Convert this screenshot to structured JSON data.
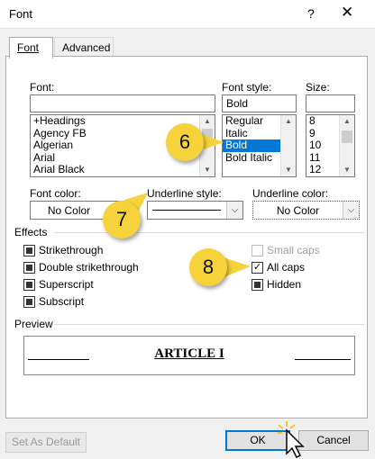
{
  "window": {
    "title": "Font",
    "help": "?",
    "close": "✕"
  },
  "tabs": [
    {
      "label": "Font"
    },
    {
      "label": "Advanced"
    }
  ],
  "font": {
    "label": "Font:",
    "value": "",
    "items": [
      "+Headings",
      "Agency FB",
      "Algerian",
      "Arial",
      "Arial Black"
    ]
  },
  "font_style": {
    "label": "Font style:",
    "value": "Bold",
    "items": [
      "Regular",
      "Italic",
      "Bold",
      "Bold Italic"
    ],
    "selected": "Bold"
  },
  "size": {
    "label": "Size:",
    "value": "",
    "items": [
      "8",
      "9",
      "10",
      "11",
      "12"
    ]
  },
  "font_color": {
    "label": "Font color:",
    "value": "No Color"
  },
  "underline_style": {
    "label": "Underline style:",
    "value": ""
  },
  "underline_color": {
    "label": "Underline color:",
    "value": "No Color"
  },
  "effects": {
    "label": "Effects",
    "left": [
      {
        "label": "Strikethrough",
        "state": "indeterminate"
      },
      {
        "label": "Double strikethrough",
        "state": "indeterminate"
      },
      {
        "label": "Superscript",
        "state": "indeterminate"
      },
      {
        "label": "Subscript",
        "state": "indeterminate"
      }
    ],
    "right": [
      {
        "label": "Small caps",
        "state": "disabled"
      },
      {
        "label": "All caps",
        "state": "checked"
      },
      {
        "label": "Hidden",
        "state": "indeterminate"
      }
    ]
  },
  "preview": {
    "label": "Preview",
    "text": "ARTICLE I"
  },
  "buttons": {
    "set_default": "Set As Default",
    "ok": "OK",
    "cancel": "Cancel"
  },
  "callouts": [
    "6",
    "7",
    "8"
  ],
  "colors": {
    "accent": "#0078d7",
    "callout": "#f6d33a"
  }
}
